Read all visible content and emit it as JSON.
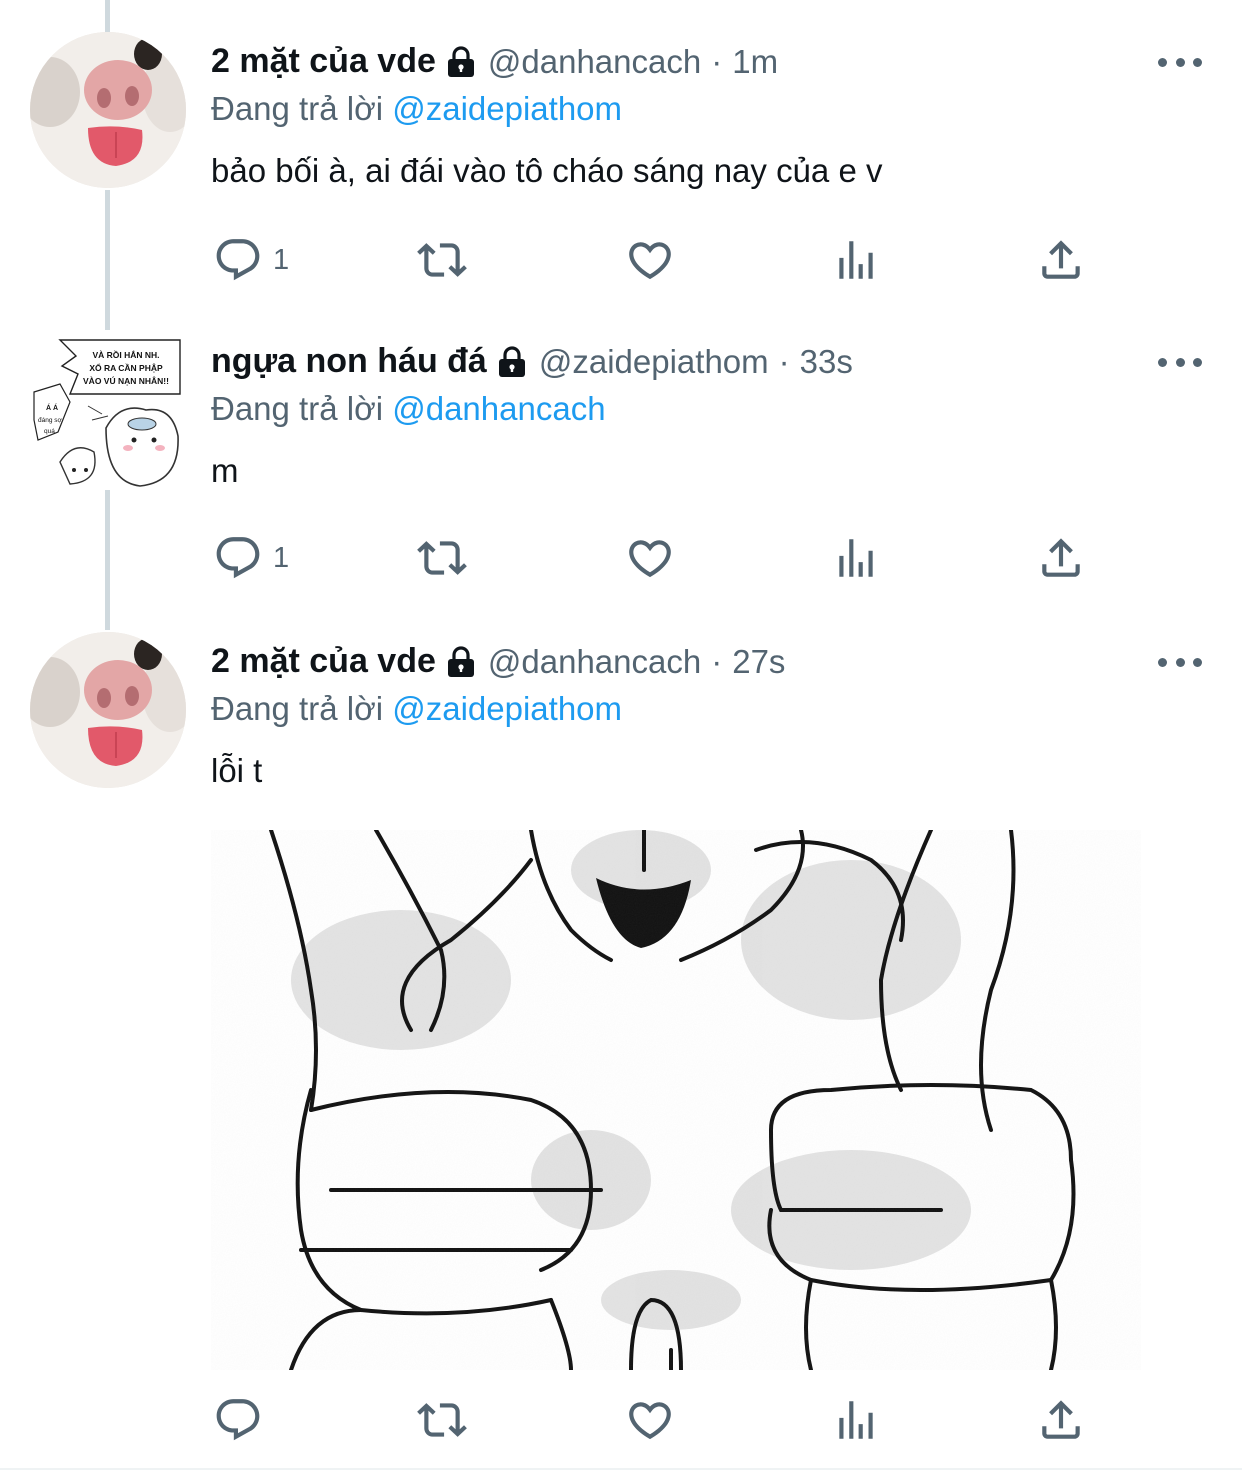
{
  "colors": {
    "accent": "#1d9bf0",
    "secondary_text": "#536471",
    "primary_text": "#0f1419",
    "thread_line": "#cfd9de"
  },
  "tweets": [
    {
      "name": "2 mặt của vde",
      "handle": "@danhancach",
      "time": "1m",
      "separator": "·",
      "reply_prefix": "Đang trả lời",
      "reply_to": "@zaidepiathom",
      "text": "bảo bối à, ai đái vào tô cháo sáng nay của e v",
      "reply_count": "1",
      "avatar": "cat-tongue-avatar"
    },
    {
      "name": "ngựa non háu đá",
      "handle": "@zaidepiathom",
      "time": "33s",
      "separator": "·",
      "reply_prefix": "Đang trả lời",
      "reply_to": "@danhancach",
      "text": "m",
      "reply_count": "1",
      "avatar": "comic-avatar",
      "avatar_text": [
        "VÀ RỒI HẮN NH.",
        "XỔ RA CẦN PHẬP",
        "VÀO VÚ NẠN NHÂN!!",
        "Á Á",
        "đáng sợ",
        "quá"
      ]
    },
    {
      "name": "2 mặt của vde",
      "handle": "@danhancach",
      "time": "27s",
      "separator": "·",
      "reply_prefix": "Đang trả lời",
      "reply_to": "@zaidepiathom",
      "text": "lỗi t",
      "reply_count": "",
      "avatar": "cat-tongue-avatar",
      "media": "hands-drawing-image"
    }
  ],
  "icons": [
    "reply-icon",
    "retweet-icon",
    "like-icon",
    "analytics-icon",
    "share-icon",
    "more-icon",
    "lock-icon"
  ]
}
